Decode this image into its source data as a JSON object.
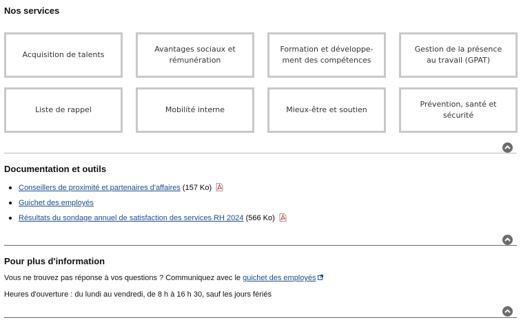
{
  "services": {
    "title": "Nos services",
    "tiles": [
      "Acquisition de talents",
      "Avantages sociaux et\nrémunération",
      "Formation et développe-\nment des compétences",
      "Gestion de la présence\nau travail (GPAT)",
      "Liste de rappel",
      "Mobilité interne",
      "Mieux-être et soutien",
      "Prévention, santé et\nsécurité"
    ]
  },
  "documentation": {
    "title": "Documentation et outils",
    "items": [
      {
        "link": "Conseillers de proximité et partenaires d'affaires",
        "size": " (157 Ko)",
        "icon": "pdf-icon"
      },
      {
        "link": "Guichet des employés",
        "size": "",
        "icon": ""
      },
      {
        "link": "Résultats du sondage annuel de satisfaction des services RH 2024",
        "size": " (566 Ko)",
        "icon": "pdf-icon"
      }
    ]
  },
  "info": {
    "title": "Pour plus d'information",
    "question_text": "Vous ne trouvez pas réponse à vos questions ? Communiquez avec le ",
    "question_link": "guichet des employés",
    "hours": "Heures d'ouverture : du lundi au vendredi, de 8 h à 16 h 30, sauf les jours fériés"
  },
  "icons": {
    "back_to_top": "chevron-up-circle-icon",
    "pdf": "pdf-icon",
    "external": "external-link-icon"
  },
  "colors": {
    "link": "#1a4d8f",
    "tile_border": "#c8c8c8",
    "top_button": "#6b6b6b"
  }
}
